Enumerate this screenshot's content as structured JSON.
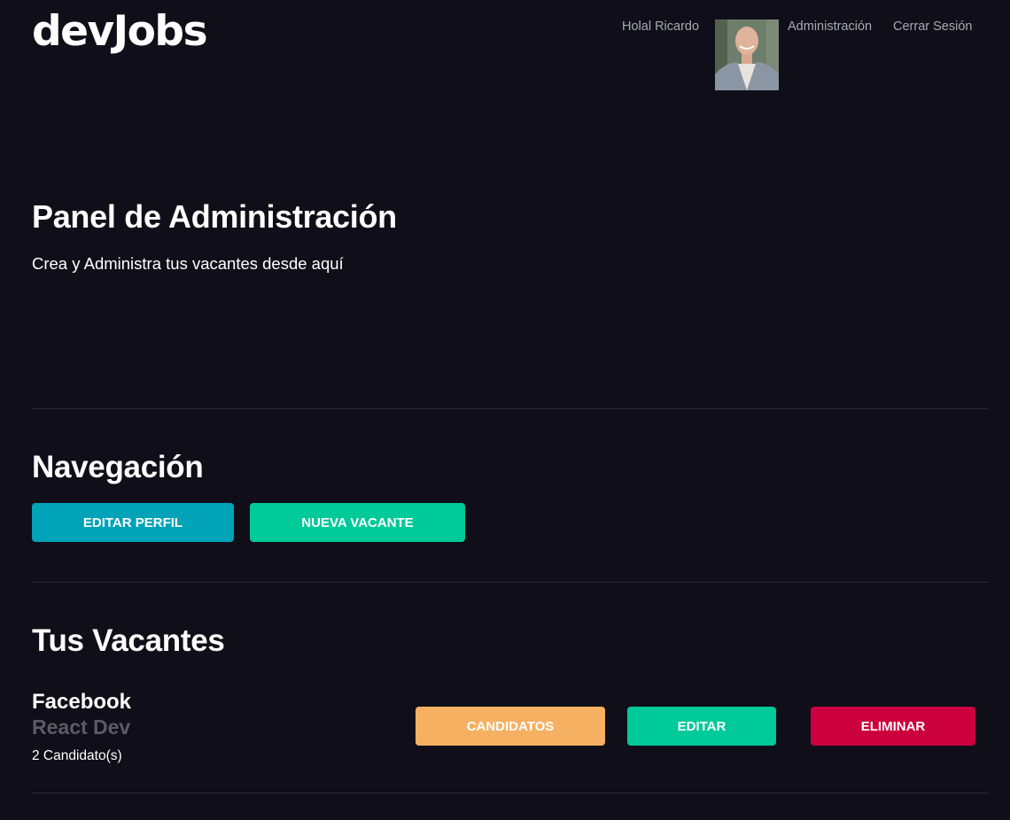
{
  "header": {
    "logo": "devJobs",
    "greeting": "Holal Ricardo",
    "nav": {
      "admin_label": "Administración",
      "logout_label": "Cerrar Sesión"
    }
  },
  "hero": {
    "title": "Panel de Administración",
    "subtitle": "Crea y Administra tus vacantes desde aquí"
  },
  "navigation": {
    "title": "Navegación",
    "edit_profile_label": "Editar Perfil",
    "new_vacancy_label": "Nueva Vacante"
  },
  "vacancies": {
    "title": "Tus Vacantes",
    "items": [
      {
        "company": "Facebook",
        "position": "React Dev",
        "candidates": "2 Candidato(s)",
        "candidates_label": "Candidatos",
        "edit_label": "Editar",
        "delete_label": "Eliminar"
      }
    ]
  },
  "colors": {
    "background": "#100f19",
    "primary": "#00a3b8",
    "success": "#00c99a",
    "warning": "#f5b062",
    "danger": "#cc003f"
  }
}
